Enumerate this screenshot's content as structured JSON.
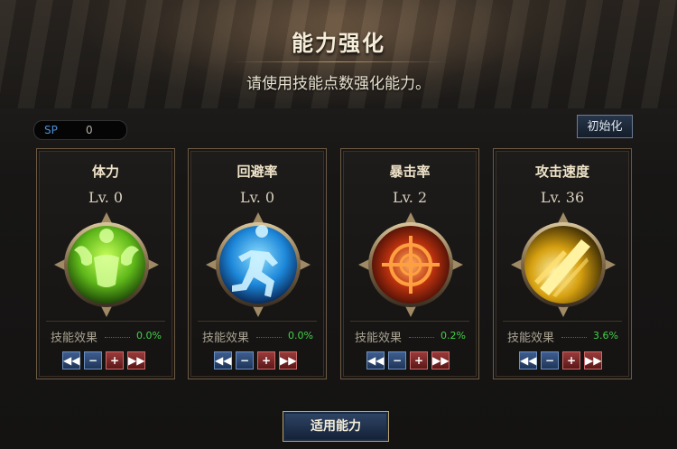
{
  "header": {
    "title": "能力强化",
    "subtitle": "请使用技能点数强化能力。"
  },
  "sp": {
    "label": "SP",
    "value": "0"
  },
  "reset_label": "初始化",
  "cards": [
    {
      "name": "体力",
      "level": "Lv. 0",
      "effect_label": "技能效果",
      "effect_value": "0.0%",
      "icon": "muscle-icon",
      "color": "#7ad22a"
    },
    {
      "name": "回避率",
      "level": "Lv. 0",
      "effect_label": "技能效果",
      "effect_value": "0.0%",
      "icon": "running-man-icon",
      "color": "#2b9de6"
    },
    {
      "name": "暴击率",
      "level": "Lv. 2",
      "effect_label": "技能效果",
      "effect_value": "0.2%",
      "icon": "crosshair-icon",
      "color": "#e7641c"
    },
    {
      "name": "攻击速度",
      "level": "Lv. 36",
      "effect_label": "技能效果",
      "effect_value": "3.6%",
      "icon": "speed-slash-icon",
      "color": "#f0c020"
    }
  ],
  "controls": {
    "first": "◀◀",
    "minus": "−",
    "plus": "+",
    "last": "▶▶"
  },
  "apply_label": "适用能力",
  "colors": {
    "effect_value": "#44d04a",
    "sp_label": "#4d8fd6",
    "card_border": "#6b5a44"
  }
}
